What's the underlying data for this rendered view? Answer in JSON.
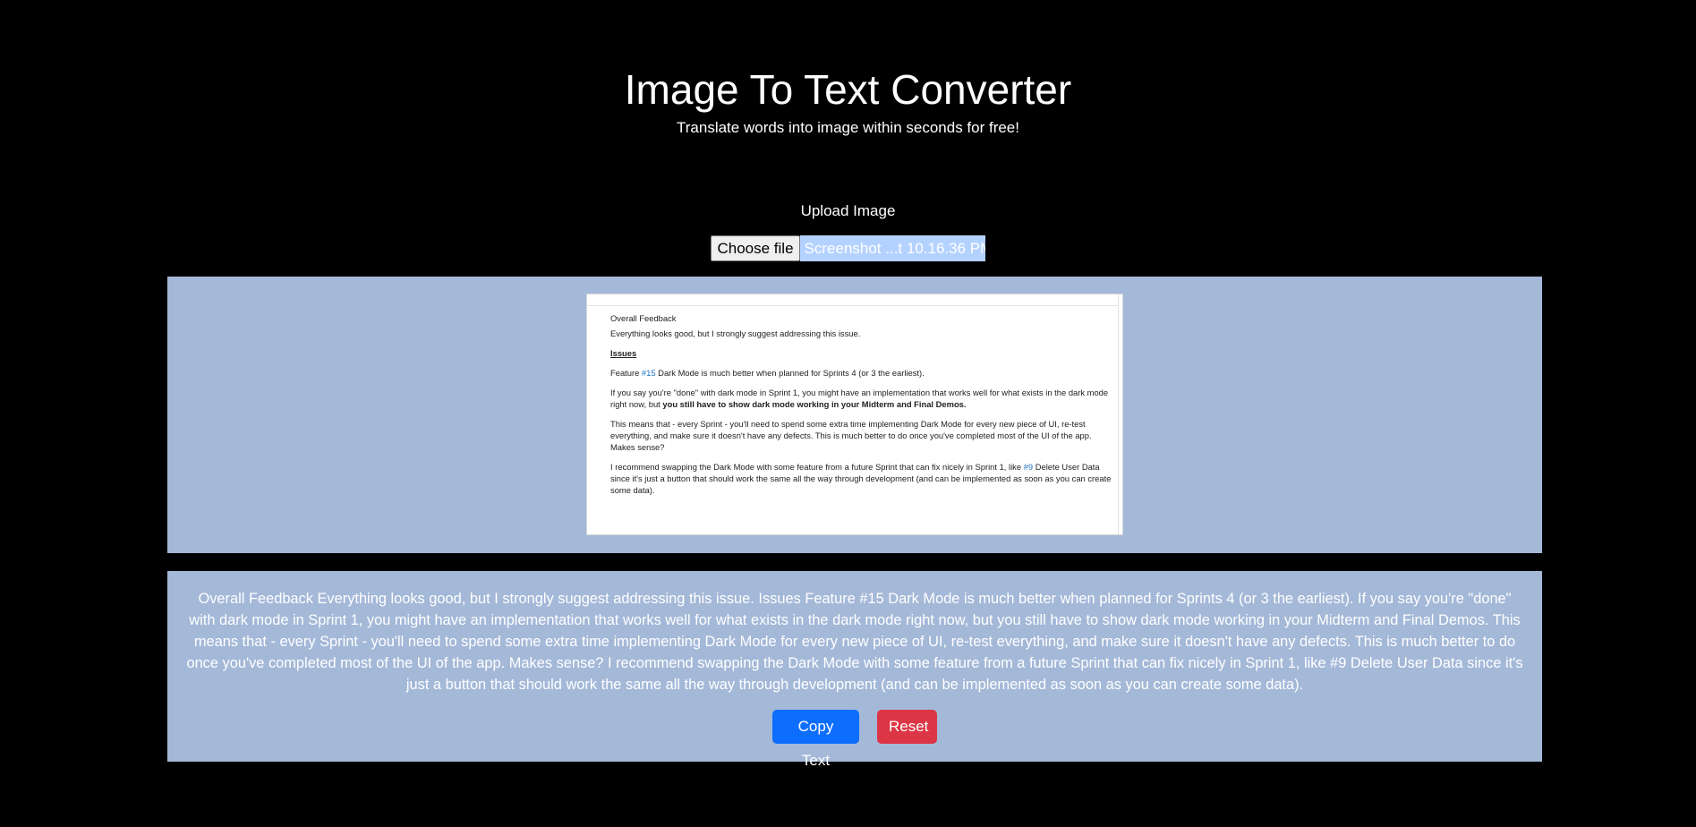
{
  "header": {
    "title": "Image To Text Converter",
    "subtitle": "Translate words into image within seconds for free!"
  },
  "upload": {
    "label": "Upload Image",
    "choose_button": "Choose file",
    "file_name": "Screenshot ...t 10.16.36 PM"
  },
  "preview": {
    "heading": "Overall Feedback",
    "line1": "Everything looks good, but I strongly suggest addressing this issue.",
    "issues_label": "Issues",
    "feature_prefix": "Feature ",
    "feature_link": "#15",
    "feature_suffix": " Dark Mode is much better when planned for Sprints 4 (or 3 the earliest).",
    "para2_start": "If you say you're \"done\" with dark mode in Sprint 1, you might have an implementation that works well for what exists in the dark mode right now, but ",
    "para2_bold": "you still have to show dark mode working in your Midterm and Final Demos.",
    "para3": "This means that - every Sprint - you'll need to spend some extra time implementing Dark Mode for every new piece of UI, re-test everything, and make sure it doesn't have any defects. This is much better to do once you've completed most of the UI of the app. Makes sense?",
    "para4_start": "I recommend swapping the Dark Mode with some feature from a future Sprint that can fix nicely in Sprint 1, like ",
    "para4_link": "#9",
    "para4_end": " Delete User Data since it's just a button that should work the same all the way through development (and can be implemented as soon as you can create some data)."
  },
  "result": {
    "text": "Overall Feedback Everything looks good, but I strongly suggest addressing this issue. Issues Feature #15 Dark Mode is much better when planned for Sprints 4 (or 3 the earliest). If you say you're \"done\" with dark mode in Sprint 1, you might have an implementation that works well for what exists in the dark mode right now, but you still have to show dark mode working in your Midterm and Final Demos. This means that - every Sprint - you'll need to spend some extra time implementing Dark Mode for every new piece of UI, re-test everything, and make sure it doesn't have any defects. This is much better to do once you've completed most of the UI of the app. Makes sense? I recommend swapping the Dark Mode with some feature from a future Sprint that can fix nicely in Sprint 1, like #9 Delete User Data since it's just a button that should work the same all the way through development (and can be implemented as soon as you can create some data).",
    "copy_button": "Copy Text",
    "reset_button": "Reset"
  },
  "colors": {
    "background": "#000000",
    "panel": "#a4b8d8",
    "copy": "#0d6efd",
    "reset": "#dc3545",
    "file_name_highlight": "#b4d2ff"
  }
}
